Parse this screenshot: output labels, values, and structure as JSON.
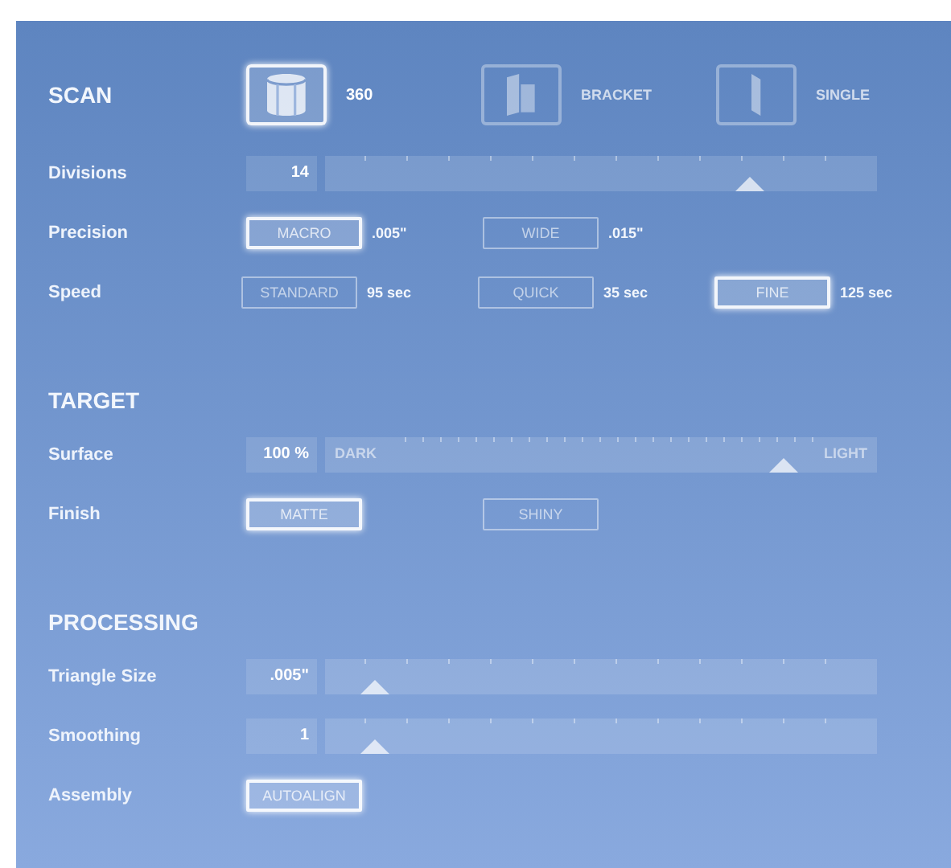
{
  "sections": [
    {
      "title": "SCAN",
      "modes": [
        {
          "kind": "cylinder",
          "label": "360",
          "selected": true
        },
        {
          "kind": "bracket",
          "label": "BRACKET",
          "selected": false
        },
        {
          "kind": "single",
          "label": "SINGLE",
          "selected": false
        }
      ],
      "rows": [
        {
          "kind": "slider",
          "label": "Divisions",
          "value": "14",
          "level": 0.77
        },
        {
          "kind": "options",
          "label": "Precision",
          "options": [
            {
              "label": "MACRO",
              "note": ".005\"",
              "selected": true
            },
            {
              "label": "WIDE",
              "note": ".015\"",
              "selected": false
            }
          ]
        },
        {
          "kind": "options",
          "label": "Speed",
          "options": [
            {
              "label": "STANDARD",
              "note": "95 sec",
              "selected": false
            },
            {
              "label": "QUICK",
              "note": "35 sec",
              "selected": false
            },
            {
              "label": "FINE",
              "note": "125 sec",
              "selected": true
            }
          ]
        }
      ]
    },
    {
      "title": "TARGET",
      "rows": [
        {
          "kind": "slider",
          "label": "Surface",
          "value": "100 %",
          "level": 0.83,
          "min_label": "DARK",
          "max_label": "LIGHT"
        },
        {
          "kind": "options",
          "label": "Finish",
          "options": [
            {
              "label": "MATTE",
              "selected": true
            },
            {
              "label": "SHINY",
              "selected": false
            }
          ]
        }
      ]
    },
    {
      "title": "PROCESSING",
      "rows": [
        {
          "kind": "slider",
          "label": "Triangle Size",
          "value": ".005\"",
          "level": 0.09
        },
        {
          "kind": "slider",
          "label": "Smoothing",
          "value": "1",
          "level": 0.09
        },
        {
          "kind": "options",
          "label": "Assembly",
          "options": [
            {
              "label": "AUTOALIGN",
              "selected": true
            }
          ]
        }
      ]
    }
  ]
}
